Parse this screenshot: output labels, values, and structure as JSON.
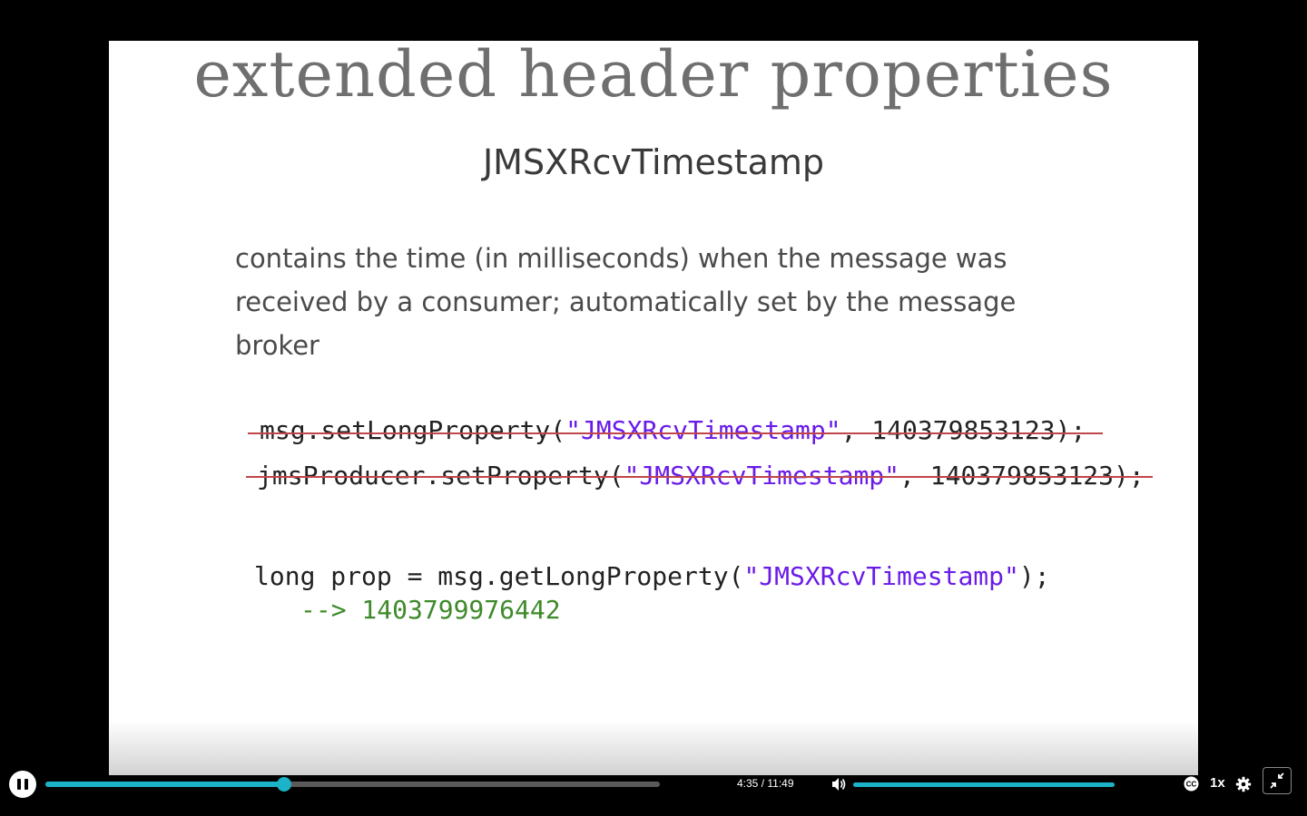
{
  "slide": {
    "title": "extended header properties",
    "subtitle": "JMSXRcvTimestamp",
    "description": "contains the time (in milliseconds) when the message was received by a consumer; automatically set by the message broker",
    "code": {
      "line1_prefix": "msg.setLongProperty(",
      "line1_string": "\"JMSXRcvTimestamp\"",
      "line1_suffix": ", 140379853123);",
      "line2_prefix": "jmsProducer.setProperty(",
      "line2_string": "\"JMSXRcvTimestamp\"",
      "line2_suffix": ", 140379853123);",
      "line3_prefix": "long prop = msg.getLongProperty(",
      "line3_string": "\"JMSXRcvTimestamp\"",
      "line3_suffix": ");",
      "result": "--> 1403799976442"
    }
  },
  "player": {
    "current_time": "4:35",
    "duration": "11:49",
    "time_display": "4:35 / 11:49",
    "progress_fraction": 0.388,
    "volume_fraction": 1.0,
    "speed_label": "1x",
    "accent_color": "#1ab3c7",
    "icons": [
      "pause-icon",
      "volume-icon",
      "closed-captions-icon",
      "gear-icon",
      "exit-fullscreen-icon"
    ]
  }
}
